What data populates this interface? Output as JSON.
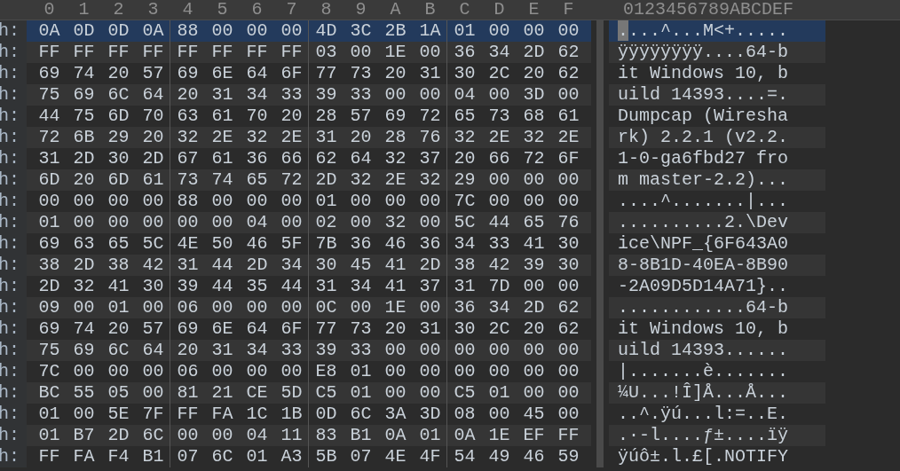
{
  "header": {
    "columns": [
      "0",
      "1",
      "2",
      "3",
      "4",
      "5",
      "6",
      "7",
      "8",
      "9",
      "A",
      "B",
      "C",
      "D",
      "E",
      "F"
    ],
    "ascii_header": "0123456789ABCDEF"
  },
  "rows": [
    {
      "offset": "h:",
      "bytes": [
        "0A",
        "0D",
        "0D",
        "0A",
        "88",
        "00",
        "00",
        "00",
        "4D",
        "3C",
        "2B",
        "1A",
        "01",
        "00",
        "00",
        "00"
      ],
      "ascii": "....^...M<+.....",
      "selected": true,
      "cursor": true
    },
    {
      "offset": "h:",
      "bytes": [
        "FF",
        "FF",
        "FF",
        "FF",
        "FF",
        "FF",
        "FF",
        "FF",
        "03",
        "00",
        "1E",
        "00",
        "36",
        "34",
        "2D",
        "62"
      ],
      "ascii": "ÿÿÿÿÿÿÿÿ....64-b",
      "selected": false,
      "cursor": false
    },
    {
      "offset": "h:",
      "bytes": [
        "69",
        "74",
        "20",
        "57",
        "69",
        "6E",
        "64",
        "6F",
        "77",
        "73",
        "20",
        "31",
        "30",
        "2C",
        "20",
        "62"
      ],
      "ascii": "it Windows 10, b",
      "selected": false,
      "cursor": false
    },
    {
      "offset": "h:",
      "bytes": [
        "75",
        "69",
        "6C",
        "64",
        "20",
        "31",
        "34",
        "33",
        "39",
        "33",
        "00",
        "00",
        "04",
        "00",
        "3D",
        "00"
      ],
      "ascii": "uild 14393....=.",
      "selected": false,
      "cursor": false
    },
    {
      "offset": "h:",
      "bytes": [
        "44",
        "75",
        "6D",
        "70",
        "63",
        "61",
        "70",
        "20",
        "28",
        "57",
        "69",
        "72",
        "65",
        "73",
        "68",
        "61"
      ],
      "ascii": "Dumpcap (Wiresha",
      "selected": false,
      "cursor": false
    },
    {
      "offset": "h:",
      "bytes": [
        "72",
        "6B",
        "29",
        "20",
        "32",
        "2E",
        "32",
        "2E",
        "31",
        "20",
        "28",
        "76",
        "32",
        "2E",
        "32",
        "2E"
      ],
      "ascii": "rk) 2.2.1 (v2.2.",
      "selected": false,
      "cursor": false
    },
    {
      "offset": "h:",
      "bytes": [
        "31",
        "2D",
        "30",
        "2D",
        "67",
        "61",
        "36",
        "66",
        "62",
        "64",
        "32",
        "37",
        "20",
        "66",
        "72",
        "6F"
      ],
      "ascii": "1-0-ga6fbd27 fro",
      "selected": false,
      "cursor": false
    },
    {
      "offset": "h:",
      "bytes": [
        "6D",
        "20",
        "6D",
        "61",
        "73",
        "74",
        "65",
        "72",
        "2D",
        "32",
        "2E",
        "32",
        "29",
        "00",
        "00",
        "00"
      ],
      "ascii": "m master-2.2)...",
      "selected": false,
      "cursor": false
    },
    {
      "offset": "h:",
      "bytes": [
        "00",
        "00",
        "00",
        "00",
        "88",
        "00",
        "00",
        "00",
        "01",
        "00",
        "00",
        "00",
        "7C",
        "00",
        "00",
        "00"
      ],
      "ascii": "....^.......|...",
      "selected": false,
      "cursor": false
    },
    {
      "offset": "h:",
      "bytes": [
        "01",
        "00",
        "00",
        "00",
        "00",
        "00",
        "04",
        "00",
        "02",
        "00",
        "32",
        "00",
        "5C",
        "44",
        "65",
        "76"
      ],
      "ascii": "..........2.\\Dev",
      "selected": false,
      "cursor": false
    },
    {
      "offset": "h:",
      "bytes": [
        "69",
        "63",
        "65",
        "5C",
        "4E",
        "50",
        "46",
        "5F",
        "7B",
        "36",
        "46",
        "36",
        "34",
        "33",
        "41",
        "30"
      ],
      "ascii": "ice\\NPF_{6F643A0",
      "selected": false,
      "cursor": false
    },
    {
      "offset": "h:",
      "bytes": [
        "38",
        "2D",
        "38",
        "42",
        "31",
        "44",
        "2D",
        "34",
        "30",
        "45",
        "41",
        "2D",
        "38",
        "42",
        "39",
        "30"
      ],
      "ascii": "8-8B1D-40EA-8B90",
      "selected": false,
      "cursor": false
    },
    {
      "offset": "h:",
      "bytes": [
        "2D",
        "32",
        "41",
        "30",
        "39",
        "44",
        "35",
        "44",
        "31",
        "34",
        "41",
        "37",
        "31",
        "7D",
        "00",
        "00"
      ],
      "ascii": "-2A09D5D14A71}..",
      "selected": false,
      "cursor": false
    },
    {
      "offset": "h:",
      "bytes": [
        "09",
        "00",
        "01",
        "00",
        "06",
        "00",
        "00",
        "00",
        "0C",
        "00",
        "1E",
        "00",
        "36",
        "34",
        "2D",
        "62"
      ],
      "ascii": "............64-b",
      "selected": false,
      "cursor": false
    },
    {
      "offset": "h:",
      "bytes": [
        "69",
        "74",
        "20",
        "57",
        "69",
        "6E",
        "64",
        "6F",
        "77",
        "73",
        "20",
        "31",
        "30",
        "2C",
        "20",
        "62"
      ],
      "ascii": "it Windows 10, b",
      "selected": false,
      "cursor": false
    },
    {
      "offset": "h:",
      "bytes": [
        "75",
        "69",
        "6C",
        "64",
        "20",
        "31",
        "34",
        "33",
        "39",
        "33",
        "00",
        "00",
        "00",
        "00",
        "00",
        "00"
      ],
      "ascii": "uild 14393......",
      "selected": false,
      "cursor": false
    },
    {
      "offset": "h:",
      "bytes": [
        "7C",
        "00",
        "00",
        "00",
        "06",
        "00",
        "00",
        "00",
        "E8",
        "01",
        "00",
        "00",
        "00",
        "00",
        "00",
        "00"
      ],
      "ascii": "|.......è.......",
      "selected": false,
      "cursor": false
    },
    {
      "offset": "h:",
      "bytes": [
        "BC",
        "55",
        "05",
        "00",
        "81",
        "21",
        "CE",
        "5D",
        "C5",
        "01",
        "00",
        "00",
        "C5",
        "01",
        "00",
        "00"
      ],
      "ascii": "¼U...!Î]Å...Å...",
      "selected": false,
      "cursor": false
    },
    {
      "offset": "h:",
      "bytes": [
        "01",
        "00",
        "5E",
        "7F",
        "FF",
        "FA",
        "1C",
        "1B",
        "0D",
        "6C",
        "3A",
        "3D",
        "08",
        "00",
        "45",
        "00"
      ],
      "ascii": "..^.ÿú...l:=..E.",
      "selected": false,
      "cursor": false
    },
    {
      "offset": "h:",
      "bytes": [
        "01",
        "B7",
        "2D",
        "6C",
        "00",
        "00",
        "04",
        "11",
        "83",
        "B1",
        "0A",
        "01",
        "0A",
        "1E",
        "EF",
        "FF"
      ],
      "ascii": ".·-l....ƒ±....ïÿ",
      "selected": false,
      "cursor": false
    },
    {
      "offset": "h:",
      "bytes": [
        "FF",
        "FA",
        "F4",
        "B1",
        "07",
        "6C",
        "01",
        "A3",
        "5B",
        "07",
        "4E",
        "4F",
        "54",
        "49",
        "46",
        "59"
      ],
      "ascii": "ÿúô±.l.£[.NOTIFY",
      "selected": false,
      "cursor": false
    }
  ]
}
